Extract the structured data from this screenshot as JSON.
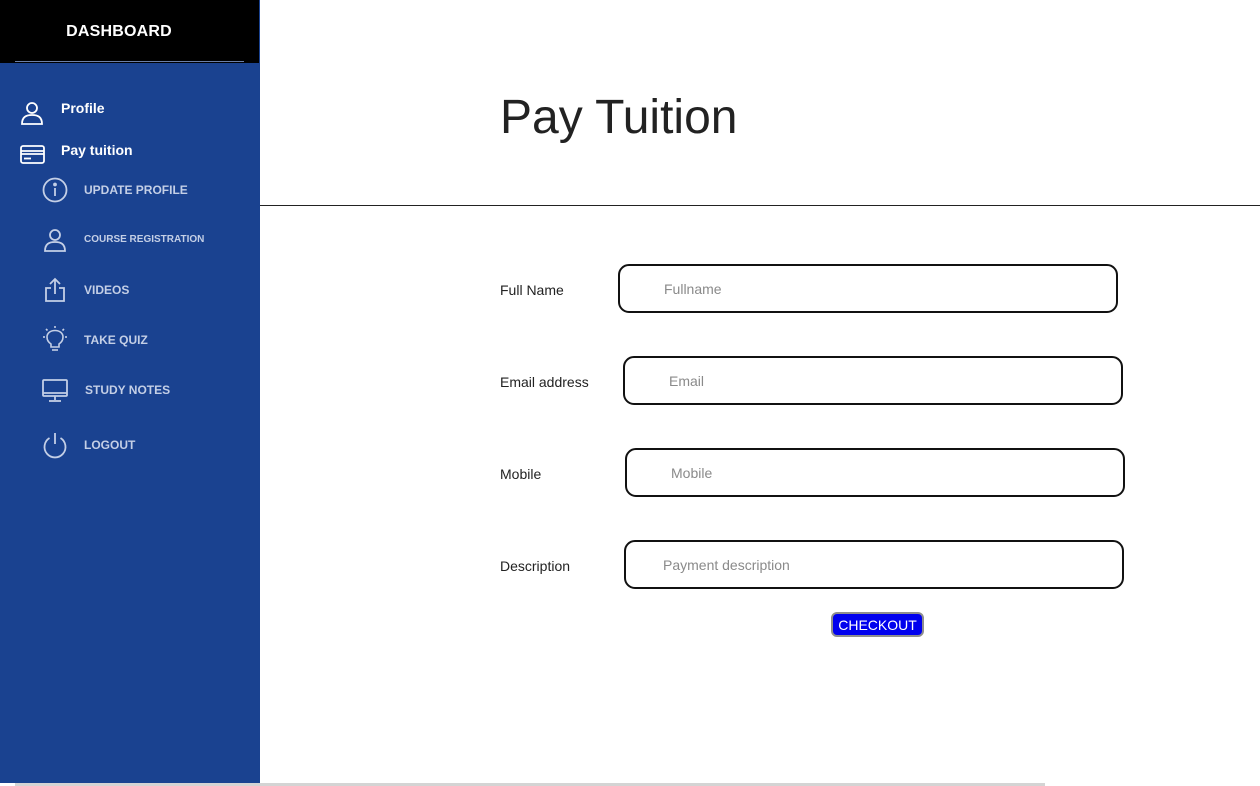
{
  "sidebar": {
    "title": "DASHBOARD",
    "background": "#1a4290",
    "header_background": "#000000",
    "primary_items": [
      {
        "label": "Profile",
        "icon": "user-icon"
      },
      {
        "label": "Pay tuition",
        "icon": "credit-card-icon"
      }
    ],
    "secondary_items": [
      {
        "label": "UPDATE PROFILE",
        "icon": "info-icon"
      },
      {
        "label": "COURSE REGISTRATION",
        "icon": "user-icon"
      },
      {
        "label": "VIDEOS",
        "icon": "upload-icon"
      },
      {
        "label": "TAKE QUIZ",
        "icon": "lightbulb-icon"
      },
      {
        "label": "STUDY NOTES",
        "icon": "monitor-icon"
      },
      {
        "label": "LOGOUT",
        "icon": "power-icon"
      }
    ]
  },
  "main": {
    "title": "Pay Tuition",
    "form": {
      "fields": [
        {
          "label": "Full Name",
          "placeholder": "Fullname",
          "value": ""
        },
        {
          "label": "Email address",
          "placeholder": "Email",
          "value": ""
        },
        {
          "label": "Mobile",
          "placeholder": "Mobile",
          "value": ""
        },
        {
          "label": "Description",
          "placeholder": "Payment description",
          "value": ""
        }
      ],
      "submit_label": "CHECKOUT",
      "submit_color": "#0000ee"
    }
  }
}
